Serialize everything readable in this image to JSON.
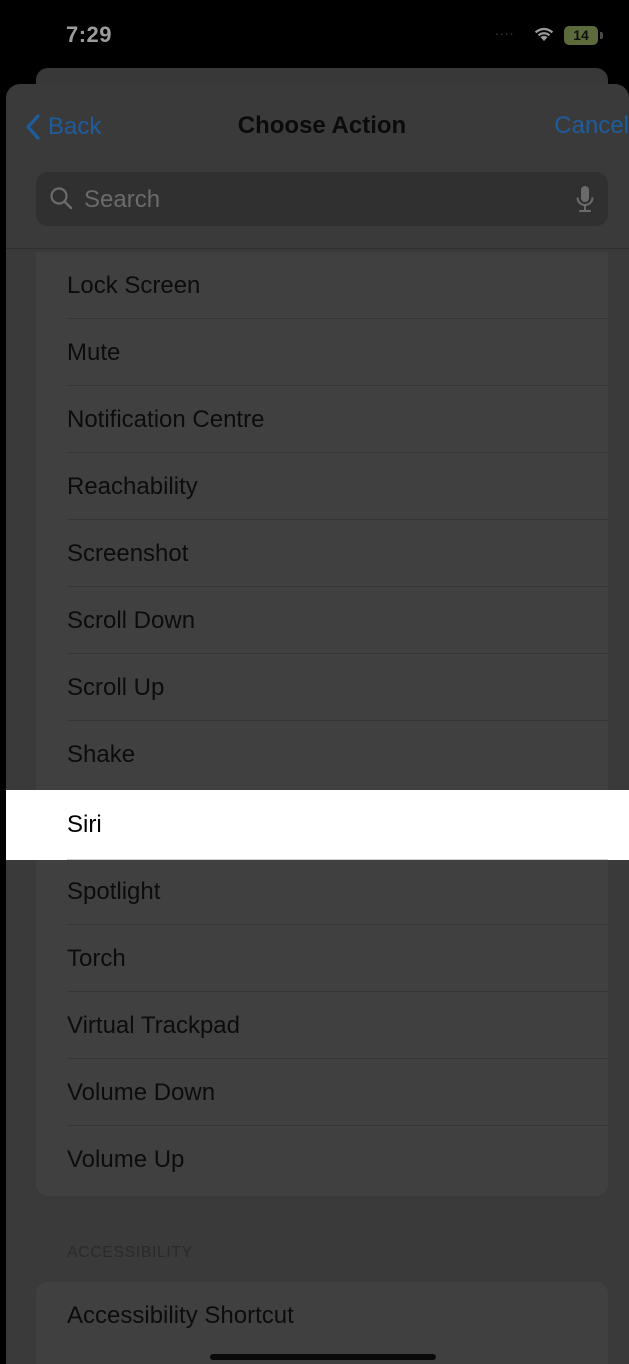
{
  "status_bar": {
    "time": "7:29",
    "signal": "....",
    "battery": "14"
  },
  "nav": {
    "back_label": "Back",
    "title": "Choose Action",
    "cancel_label": "Cancel"
  },
  "search": {
    "placeholder": "Search"
  },
  "actions": [
    "Lock Screen",
    "Mute",
    "Notification Centre",
    "Reachability",
    "Screenshot",
    "Scroll Down",
    "Scroll Up",
    "Shake",
    "Siri",
    "Spotlight",
    "Torch",
    "Virtual Trackpad",
    "Volume Down",
    "Volume Up"
  ],
  "selected_action": "Siri",
  "accessibility_section": {
    "header": "ACCESSIBILITY",
    "items": [
      "Accessibility Shortcut"
    ]
  },
  "colors": {
    "accent": "#1f5c9c",
    "highlight": "#ffffff",
    "dim_overlay": "#3a3a3a"
  }
}
